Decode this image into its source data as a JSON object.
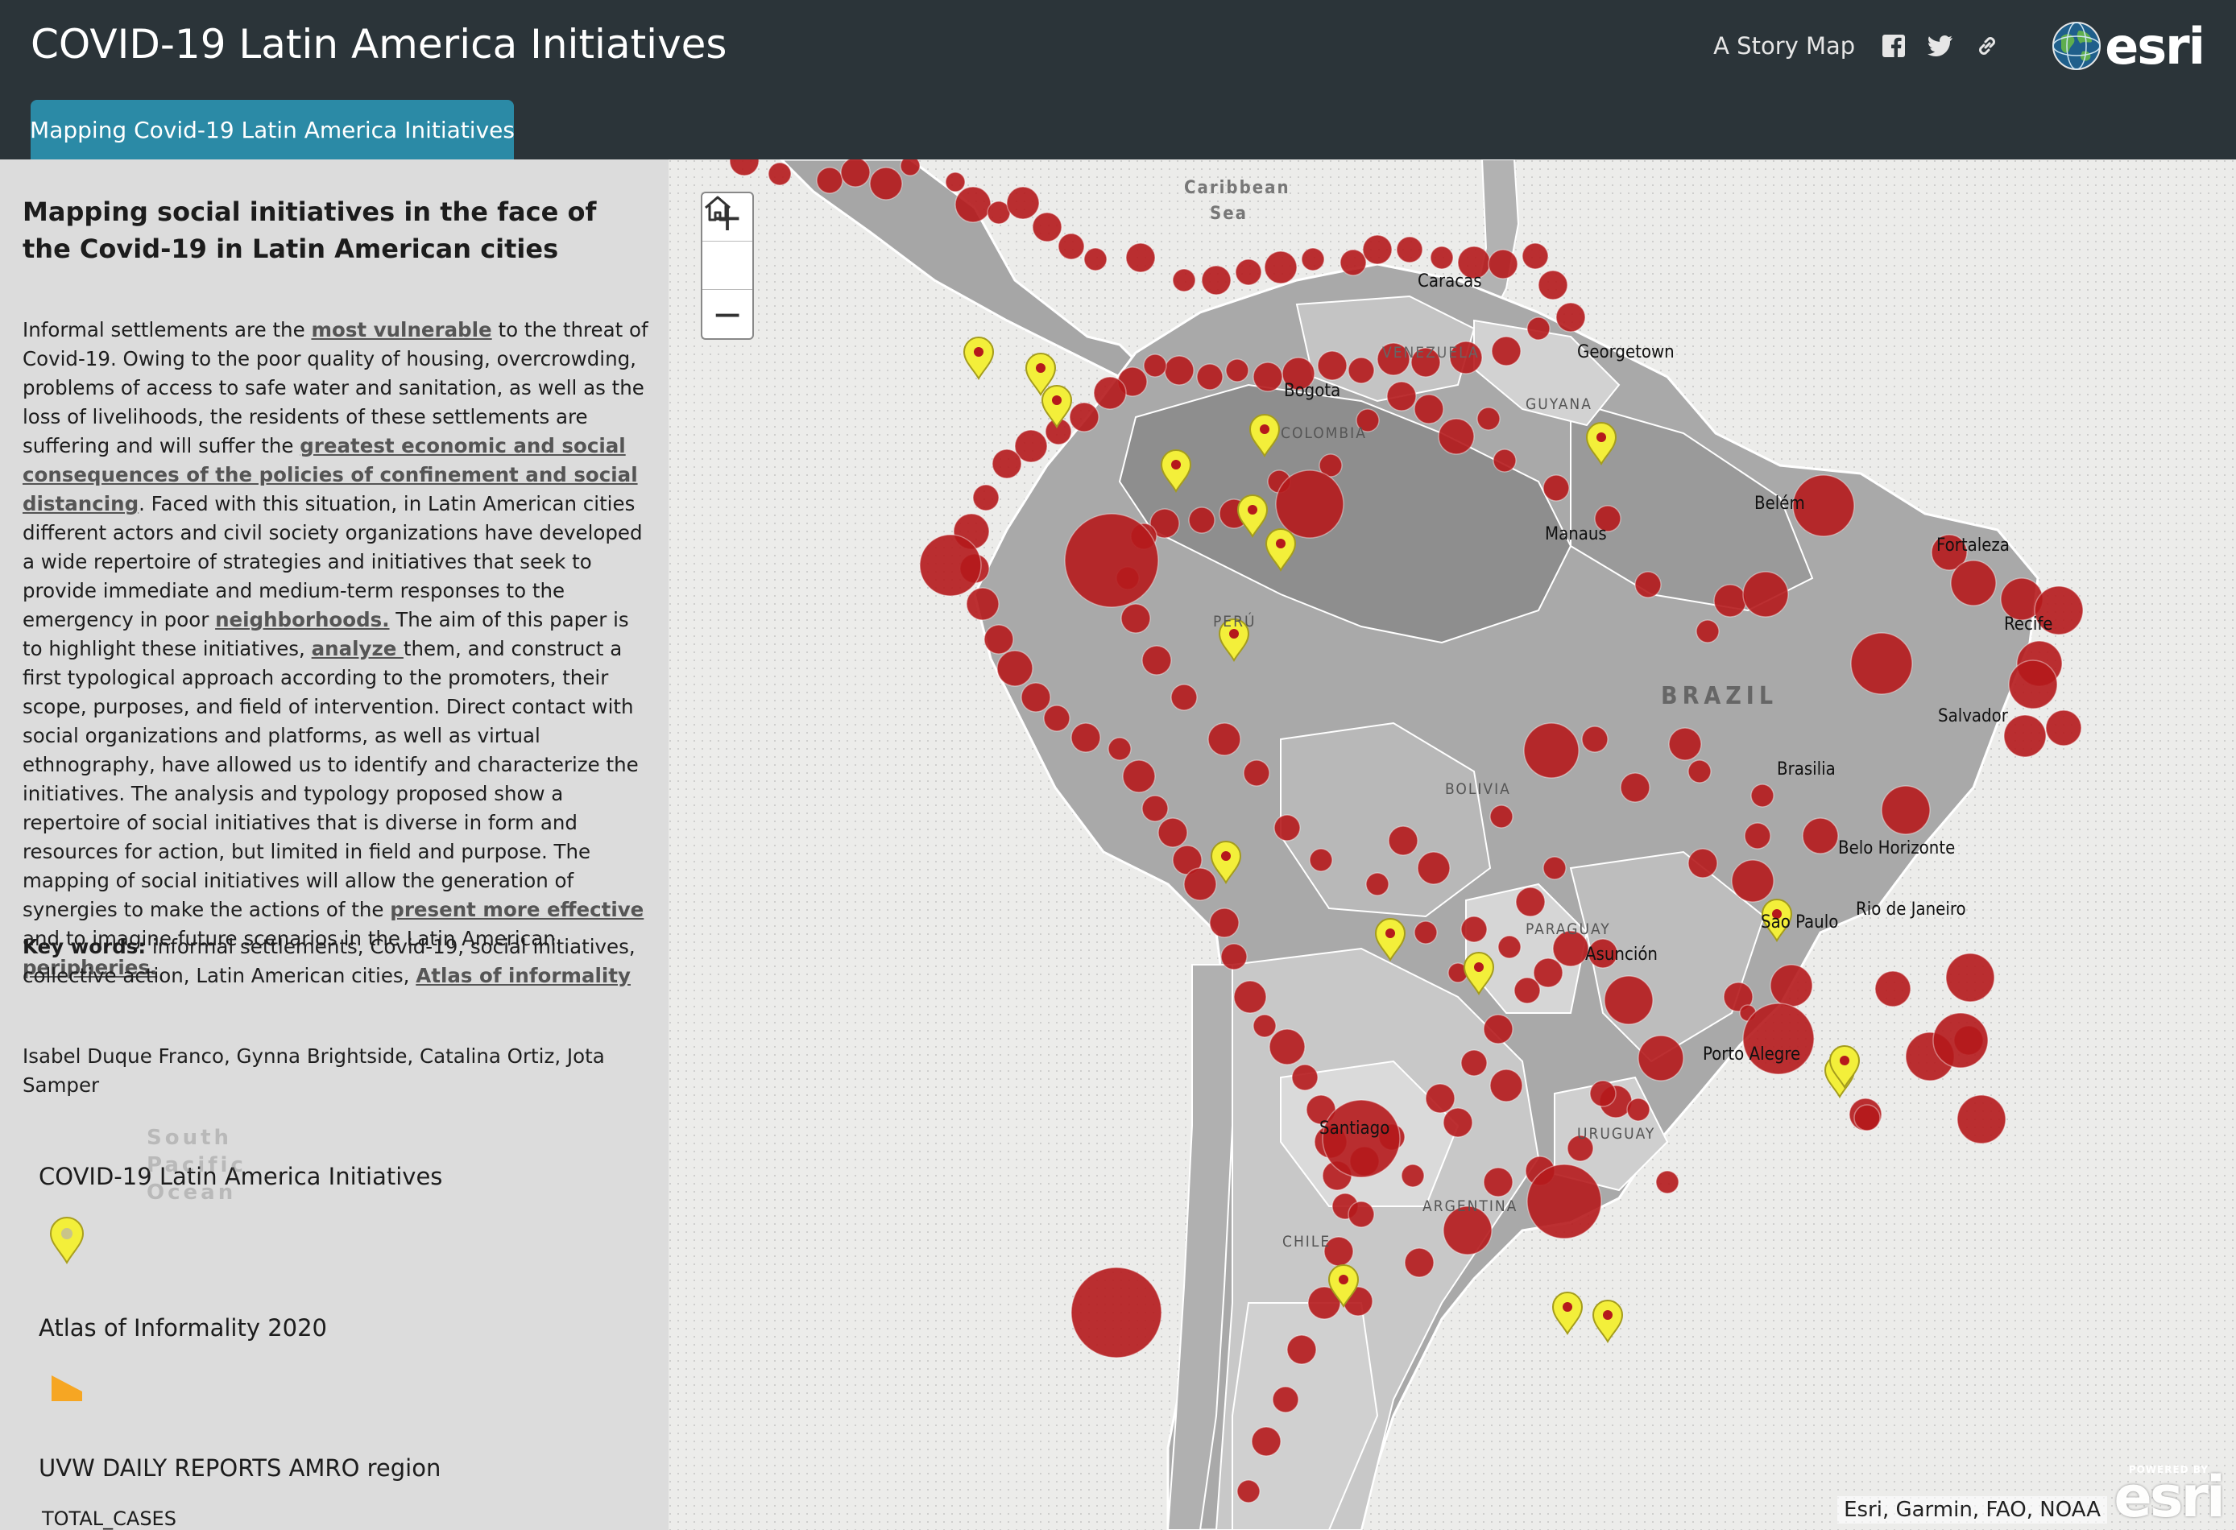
{
  "header": {
    "title": "COVID-19 Latin America Initiatives",
    "story_map_link": "A Story Map",
    "icons": [
      "facebook-icon",
      "twitter-icon",
      "link-icon",
      "esri-globe-icon"
    ],
    "esri_logo": "esri"
  },
  "tabs": [
    {
      "label": "Mapping Covid-19 Latin America Initiatives",
      "active": true
    }
  ],
  "panel": {
    "title": "Mapping social initiatives in the face of the Covid-19 in Latin American cities",
    "abstract": {
      "p1": "Informal settlements are the ",
      "l1": "most vulnerable",
      "p2": " to the threat of Covid-19. Owing to the poor quality of housing, overcrowding, problems of access to safe water and sanitation, as well as the loss of livelihoods, the residents of these settlements are suffering and will suffer the ",
      "l2": "greatest economic and social consequences of the policies of confinement and social distancing",
      "p3": ". Faced with this situation, in Latin American cities different actors and civil society organizations have developed a wide repertoire of strategies and initiatives that seek to provide immediate and medium-term responses to the emergency in poor ",
      "l3": "neighborhoods.",
      "p4": " The aim of this paper is to highlight these initiatives, ",
      "l4": "analyze ",
      "p5": "them, and construct a first typological approach according to the promoters, their scope, purposes, and field of intervention. Direct contact with social organizations and platforms, as well as virtual ethnography, have allowed us to identify and characterize the initiatives. The analysis and typology proposed show a repertoire of social initiatives that is diverse in form and resources for action, but limited in field and purpose. The mapping of social initiatives will allow the generation of synergies to make the actions of the ",
      "l5": "present more effective ",
      "p6": "and to imagine future scenarios in the Latin American ",
      "l6": "peripheries."
    },
    "keywords_label": "Key words:",
    "keywords_text": " informal settlements, Covid-19, social initiatives, collective action, Latin American cities, ",
    "keywords_link": "Atlas of informality",
    "authors": "Isabel Duque Franco, Gynna Brightside, Catalina Ortiz, Jota Samper"
  },
  "legend": [
    {
      "title": "COVID-19 Latin America Initiatives",
      "icon": "yellow-pin-icon",
      "color": "#f3ef3a"
    },
    {
      "title": "Atlas of Informality 2020",
      "icon": "orange-polygon-icon",
      "color": "#f6a623"
    },
    {
      "title": "UVW DAILY REPORTS AMRO region",
      "subtitle": "TOTAL_CASES"
    }
  ],
  "map": {
    "labels": [
      {
        "text": "Caribbean",
        "style": "sea"
      },
      {
        "text": "Sea",
        "style": "sea"
      },
      {
        "text": "Caracas",
        "style": "city"
      },
      {
        "text": "Georgetown",
        "style": "city"
      },
      {
        "text": "VENEZUELA",
        "style": "country"
      },
      {
        "text": "GUYANA",
        "style": "country"
      },
      {
        "text": "Bogota",
        "style": "city"
      },
      {
        "text": "COLOMBIA",
        "style": "country"
      },
      {
        "text": "Belém",
        "style": "city"
      },
      {
        "text": "Manaus",
        "style": "city"
      },
      {
        "text": "Fortaleza",
        "style": "city"
      },
      {
        "text": "Recife",
        "style": "city"
      },
      {
        "text": "PERÚ",
        "style": "country"
      },
      {
        "text": "BRAZIL",
        "style": "bigcountry"
      },
      {
        "text": "Salvador",
        "style": "city"
      },
      {
        "text": "Brasilia",
        "style": "city"
      },
      {
        "text": "BOLIVIA",
        "style": "country"
      },
      {
        "text": "Belo Horizonte",
        "style": "city"
      },
      {
        "text": "Rio de Janeiro",
        "style": "city"
      },
      {
        "text": "Sao Paulo",
        "style": "city"
      },
      {
        "text": "PARAGUAY",
        "style": "country"
      },
      {
        "text": "Asunción",
        "style": "city"
      },
      {
        "text": "Porto Alegre",
        "style": "city"
      },
      {
        "text": "Santiago",
        "style": "city"
      },
      {
        "text": "URUGUAY",
        "style": "country"
      },
      {
        "text": "ARGENTINA",
        "style": "country"
      },
      {
        "text": "CHILE",
        "style": "country"
      },
      {
        "text": "South",
        "style": "sea"
      },
      {
        "text": "Pacific",
        "style": "sea"
      },
      {
        "text": "Ocean",
        "style": "sea"
      }
    ],
    "zoom_controls": {
      "in": "+",
      "home": "home-icon",
      "out": "−"
    },
    "attribution": "Esri, Garmin, FAO, NOAA",
    "powered_by": "POWERED BY",
    "powered_logo": "esri",
    "colors": {
      "case_circle": "#b5191c",
      "pin": "#f3ef3a",
      "land_dark": "#8c8c8c",
      "land_mid": "#a8a8a8",
      "land_light": "#c9c9c9",
      "ocean": "#e9e9e9"
    }
  }
}
